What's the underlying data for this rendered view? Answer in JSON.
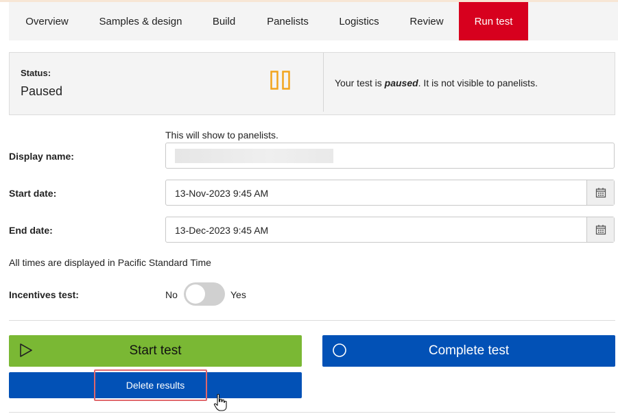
{
  "tabs": [
    {
      "label": "Overview"
    },
    {
      "label": "Samples & design"
    },
    {
      "label": "Build"
    },
    {
      "label": "Panelists"
    },
    {
      "label": "Logistics"
    },
    {
      "label": "Review"
    },
    {
      "label": "Run test",
      "active": true
    }
  ],
  "status": {
    "label": "Status:",
    "value": "Paused",
    "icon": "pause-icon",
    "message_prefix": "Your test is ",
    "message_emphasis": "paused",
    "message_suffix": ". It is not visible to panelists."
  },
  "display_name": {
    "hint": "This will show to panelists.",
    "label": "Display name:",
    "value": ""
  },
  "start_date": {
    "label": "Start date:",
    "value": "13-Nov-2023 9:45 AM",
    "icon": "calendar-icon"
  },
  "end_date": {
    "label": "End date:",
    "value": "13-Dec-2023 9:45 AM",
    "icon": "calendar-icon"
  },
  "timezone_note": "All times are displayed in Pacific Standard Time",
  "incentives": {
    "label": "Incentives test:",
    "off_label": "No",
    "on_label": "Yes",
    "on": false
  },
  "actions": {
    "start_label": "Start test",
    "start_icon": "play-icon",
    "complete_label": "Complete test",
    "complete_icon": "circle-icon",
    "delete_label": "Delete results"
  },
  "colors": {
    "accent_red": "#d7001e",
    "start_green": "#7ab834",
    "action_blue": "#0251b6",
    "pause_orange": "#f2a31b",
    "highlight": "#e0676b"
  }
}
